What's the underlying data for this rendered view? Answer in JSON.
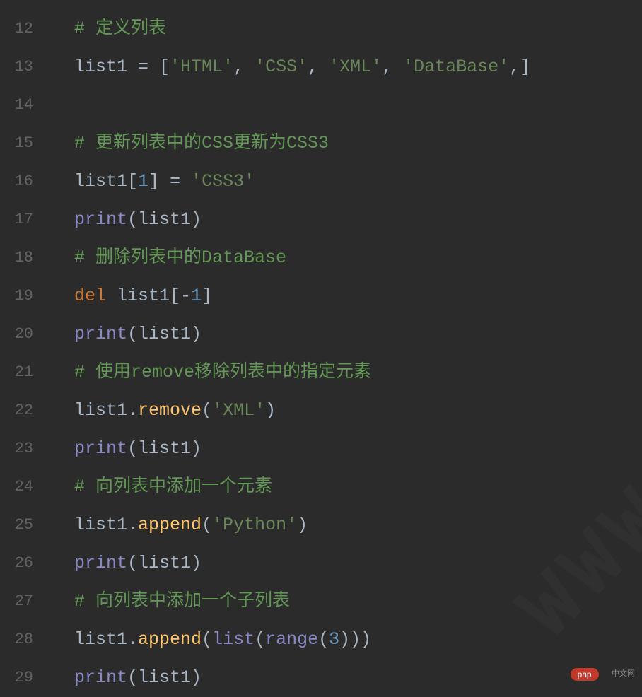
{
  "editor": {
    "startLine": 12,
    "lines": [
      {
        "num": 12,
        "tokens": [
          {
            "t": "comment",
            "v": "# 定义列表"
          }
        ]
      },
      {
        "num": 13,
        "tokens": [
          {
            "t": "ident",
            "v": "list1 "
          },
          {
            "t": "op",
            "v": "= "
          },
          {
            "t": "punct",
            "v": "["
          },
          {
            "t": "string",
            "v": "'HTML'"
          },
          {
            "t": "punct",
            "v": ", "
          },
          {
            "t": "string",
            "v": "'CSS'"
          },
          {
            "t": "punct",
            "v": ", "
          },
          {
            "t": "string",
            "v": "'XML'"
          },
          {
            "t": "punct",
            "v": ", "
          },
          {
            "t": "string",
            "v": "'DataBase'"
          },
          {
            "t": "punct",
            "v": ",]"
          }
        ]
      },
      {
        "num": 14,
        "tokens": []
      },
      {
        "num": 15,
        "tokens": [
          {
            "t": "comment",
            "v": "# 更新列表中的CSS更新为CSS3"
          }
        ]
      },
      {
        "num": 16,
        "tokens": [
          {
            "t": "ident",
            "v": "list1"
          },
          {
            "t": "punct",
            "v": "["
          },
          {
            "t": "number",
            "v": "1"
          },
          {
            "t": "punct",
            "v": "] "
          },
          {
            "t": "op",
            "v": "= "
          },
          {
            "t": "string",
            "v": "'CSS3'"
          }
        ]
      },
      {
        "num": 17,
        "tokens": [
          {
            "t": "builtin",
            "v": "print"
          },
          {
            "t": "punct",
            "v": "("
          },
          {
            "t": "ident",
            "v": "list1"
          },
          {
            "t": "punct",
            "v": ")"
          }
        ]
      },
      {
        "num": 18,
        "tokens": [
          {
            "t": "comment",
            "v": "# 删除列表中的DataBase"
          }
        ]
      },
      {
        "num": 19,
        "tokens": [
          {
            "t": "keyword",
            "v": "del "
          },
          {
            "t": "ident",
            "v": "list1"
          },
          {
            "t": "punct",
            "v": "["
          },
          {
            "t": "op",
            "v": "-"
          },
          {
            "t": "number",
            "v": "1"
          },
          {
            "t": "punct",
            "v": "]"
          }
        ]
      },
      {
        "num": 20,
        "tokens": [
          {
            "t": "builtin",
            "v": "print"
          },
          {
            "t": "punct",
            "v": "("
          },
          {
            "t": "ident",
            "v": "list1"
          },
          {
            "t": "punct",
            "v": ")"
          }
        ]
      },
      {
        "num": 21,
        "tokens": [
          {
            "t": "comment",
            "v": "# 使用remove移除列表中的指定元素"
          }
        ]
      },
      {
        "num": 22,
        "tokens": [
          {
            "t": "ident",
            "v": "list1"
          },
          {
            "t": "punct",
            "v": "."
          },
          {
            "t": "method",
            "v": "remove"
          },
          {
            "t": "punct",
            "v": "("
          },
          {
            "t": "string",
            "v": "'XML'"
          },
          {
            "t": "punct",
            "v": ")"
          }
        ]
      },
      {
        "num": 23,
        "tokens": [
          {
            "t": "builtin",
            "v": "print"
          },
          {
            "t": "punct",
            "v": "("
          },
          {
            "t": "ident",
            "v": "list1"
          },
          {
            "t": "punct",
            "v": ")"
          }
        ]
      },
      {
        "num": 24,
        "tokens": [
          {
            "t": "comment",
            "v": "# 向列表中添加一个元素"
          }
        ]
      },
      {
        "num": 25,
        "tokens": [
          {
            "t": "ident",
            "v": "list1"
          },
          {
            "t": "punct",
            "v": "."
          },
          {
            "t": "method",
            "v": "append"
          },
          {
            "t": "punct",
            "v": "("
          },
          {
            "t": "string",
            "v": "'Python'"
          },
          {
            "t": "punct",
            "v": ")"
          }
        ]
      },
      {
        "num": 26,
        "tokens": [
          {
            "t": "builtin",
            "v": "print"
          },
          {
            "t": "punct",
            "v": "("
          },
          {
            "t": "ident",
            "v": "list1"
          },
          {
            "t": "punct",
            "v": ")"
          }
        ]
      },
      {
        "num": 27,
        "tokens": [
          {
            "t": "comment",
            "v": "# 向列表中添加一个子列表"
          }
        ]
      },
      {
        "num": 28,
        "tokens": [
          {
            "t": "ident",
            "v": "list1"
          },
          {
            "t": "punct",
            "v": "."
          },
          {
            "t": "method",
            "v": "append"
          },
          {
            "t": "punct",
            "v": "("
          },
          {
            "t": "builtin",
            "v": "list"
          },
          {
            "t": "punct",
            "v": "("
          },
          {
            "t": "builtin",
            "v": "range"
          },
          {
            "t": "punct",
            "v": "("
          },
          {
            "t": "number",
            "v": "3"
          },
          {
            "t": "punct",
            "v": ")))"
          }
        ]
      },
      {
        "num": 29,
        "tokens": [
          {
            "t": "builtin",
            "v": "print"
          },
          {
            "t": "punct",
            "v": "("
          },
          {
            "t": "ident",
            "v": "list1"
          },
          {
            "t": "punct",
            "v": ")"
          }
        ]
      }
    ]
  },
  "watermark": "WWW",
  "logo": {
    "badge": "php",
    "text": "中文网"
  }
}
